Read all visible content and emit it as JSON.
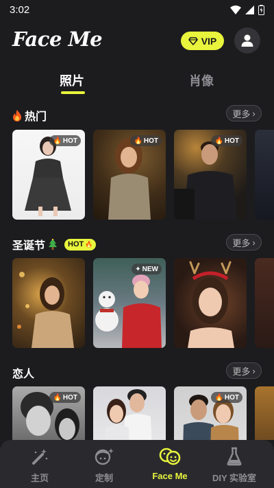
{
  "status": {
    "time": "3:02"
  },
  "header": {
    "logo": "Face Me",
    "vip_label": "VIP"
  },
  "tabs": [
    {
      "label": "照片",
      "active": true
    },
    {
      "label": "肖像",
      "active": false
    }
  ],
  "sections": [
    {
      "title": "热门",
      "icon": "fire-icon",
      "more_label": "更多",
      "badge_pill": "",
      "cards": [
        {
          "badge": "HOT"
        },
        {
          "badge": "HOT"
        },
        {
          "badge": "HOT"
        },
        {
          "badge": ""
        }
      ]
    },
    {
      "title": "圣诞节",
      "icon": "christmas-tree-icon",
      "more_label": "更多",
      "badge_pill": "HOT",
      "cards": [
        {
          "badge": ""
        },
        {
          "badge": "NEW"
        },
        {
          "badge": ""
        },
        {
          "badge": ""
        }
      ]
    },
    {
      "title": "恋人",
      "icon": "",
      "more_label": "更多",
      "badge_pill": "",
      "cards": [
        {
          "badge": "HOT"
        },
        {
          "badge": ""
        },
        {
          "badge": "HOT"
        },
        {
          "badge": ""
        }
      ]
    }
  ],
  "bottom_nav": [
    {
      "label": "主页",
      "icon": "magic-wand-icon",
      "active": false
    },
    {
      "label": "定制",
      "icon": "face-sparkle-icon",
      "active": false
    },
    {
      "label": "Face Me",
      "icon": "face-me-icon",
      "active": true
    },
    {
      "label": "DIY 实验室",
      "icon": "flask-icon",
      "active": false
    }
  ],
  "colors": {
    "accent": "#e8f53c",
    "background": "#1c1c1e",
    "nav_background": "#2a2a2e",
    "inactive": "#8d8d93"
  }
}
